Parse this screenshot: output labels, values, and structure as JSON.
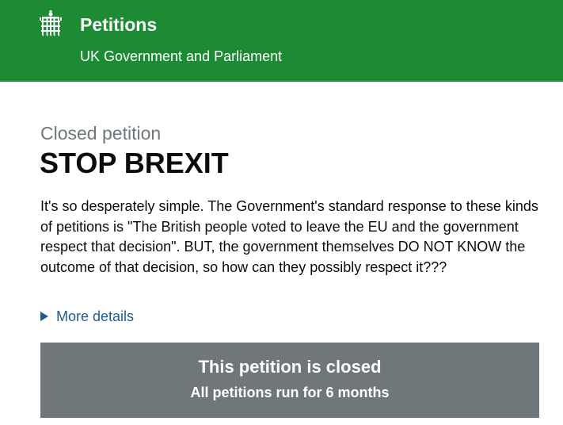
{
  "header": {
    "title": "Petitions",
    "subtitle": "UK Government and Parliament",
    "logo_icon": "portcullis-icon",
    "background_color": "#1d8b33"
  },
  "petition": {
    "status_label": "Closed petition",
    "title": "STOP BREXIT",
    "body": "It's so desperately simple. The Government's standard response to these kinds of petitions is \"The British people voted to leave the EU and the government respect that decision\". BUT, the government themselves DO NOT KNOW the outcome of that decision, so how can they possibly respect it???",
    "details_toggle_label": "More details",
    "details_icon": "triangle-right-icon"
  },
  "closed_banner": {
    "heading": "This petition is closed",
    "subtext": "All petitions run for 6 months",
    "background_color": "#6f777b"
  }
}
